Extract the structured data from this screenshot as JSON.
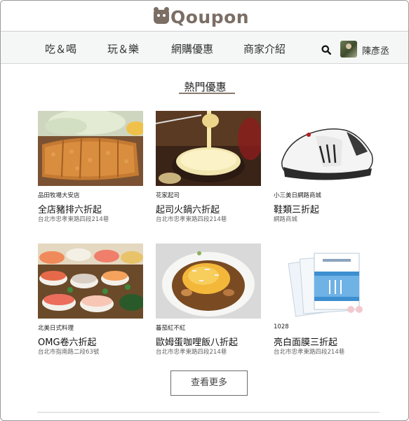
{
  "brand": {
    "logo_text": "Qoupon"
  },
  "nav": {
    "items": [
      {
        "label": "吃＆喝"
      },
      {
        "label": "玩＆樂"
      },
      {
        "label": "網購優惠"
      },
      {
        "label": "商家介紹"
      }
    ],
    "search_icon": "search-icon",
    "user_name": "陳彥丞"
  },
  "section": {
    "title": "熱門優惠"
  },
  "deals": [
    {
      "store": "品田牧場大安店",
      "title": "全店豬排六折起",
      "address": "台北市忠孝東路四段214巷",
      "image": "pork-cutlet"
    },
    {
      "store": "花家起司",
      "title": "起司火鍋六折起",
      "address": "台北市忠孝東路四段214巷",
      "image": "cheese-fondue"
    },
    {
      "store": "小三美日網路商城",
      "title": "鞋類三折起",
      "address": "網路商城",
      "image": "sneaker"
    },
    {
      "store": "北美日式料理",
      "title": "OMG卷六折起",
      "address": "台北市指南路二段63號",
      "image": "sushi-platter"
    },
    {
      "store": "蕃茄紅不紅",
      "title": "歐姆蛋咖哩飯八折起",
      "address": "台北市忠孝東路四段214巷",
      "image": "omelette-curry"
    },
    {
      "store": "1028",
      "title": "亮白面膜三折起",
      "address": "台北市忠孝東路四段214巷",
      "image": "face-mask"
    }
  ],
  "more_button": {
    "label": "查看更多"
  },
  "colors": {
    "brand": "#7b6e65",
    "nav_bg": "#f5f6f6",
    "underline": "#8a7a6e"
  }
}
